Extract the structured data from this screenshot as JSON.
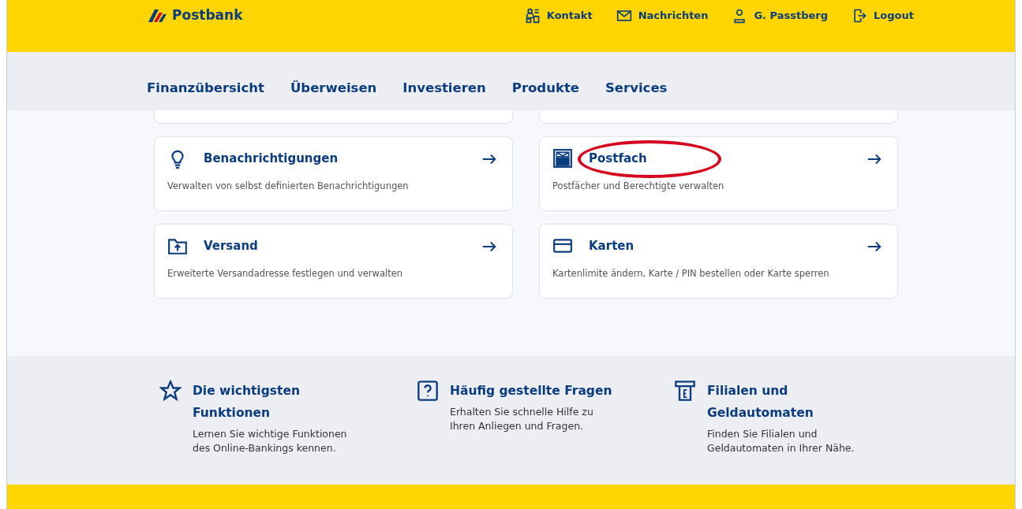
{
  "header": {
    "logo": "Postbank",
    "links": [
      {
        "kind": "contact",
        "label": "Kontakt"
      },
      {
        "kind": "mail",
        "label": "Nachrichten"
      },
      {
        "kind": "user",
        "label": "G. Passtberg"
      },
      {
        "kind": "logout",
        "label": "Logout"
      }
    ]
  },
  "nav": [
    "Finanzübersicht",
    "Überweisen",
    "Investieren",
    "Produkte",
    "Services"
  ],
  "tiles": [
    {
      "kind": "bulb",
      "title": "Benachrichtigungen",
      "description": "Verwalten von selbst definierten Benachrichtigungen",
      "highlighted": false
    },
    {
      "kind": "mailbox",
      "title": "Postfach",
      "description": "Postfächer und Berechtigte verwalten",
      "highlighted": true
    },
    {
      "kind": "folder",
      "title": "Versand",
      "description": "Erweiterte Versandadresse festlegen und verwalten",
      "highlighted": false
    },
    {
      "kind": "card",
      "title": "Karten",
      "description": "Kartenlimite ändern, Karte / PIN bestellen oder Karte sperren",
      "highlighted": false
    }
  ],
  "help": [
    {
      "kind": "star",
      "title": "Die wichtigsten Funktionen",
      "text": "Lernen Sie wichtige Funktionen des Online-Bankings kennen."
    },
    {
      "kind": "question",
      "title": "Häufig gestellte Fragen",
      "text": "Erhalten Sie schnelle Hilfe zu Ihren Anliegen und Fragen."
    },
    {
      "kind": "atm",
      "title": "Filialen und Geldautomaten",
      "text": "Finden Sie Filialen und Geldautomaten in Ihrer Nähe."
    }
  ]
}
